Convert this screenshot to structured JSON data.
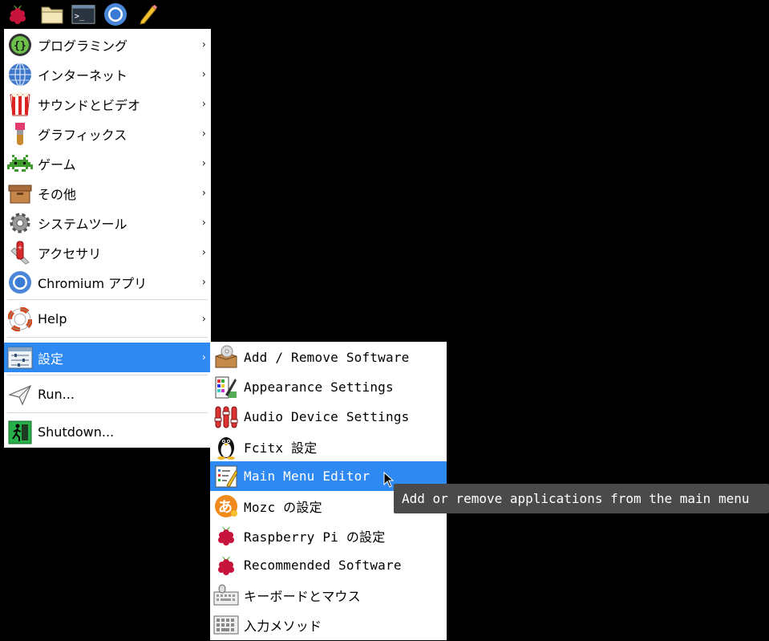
{
  "taskbar": {
    "items": [
      {
        "name": "raspberry-menu-icon"
      },
      {
        "name": "file-manager-icon"
      },
      {
        "name": "terminal-icon"
      },
      {
        "name": "chromium-icon"
      },
      {
        "name": "text-editor-icon"
      }
    ]
  },
  "main_menu": {
    "items": [
      {
        "label": "プログラミング",
        "icon": "programming-icon",
        "submenu": true
      },
      {
        "label": "インターネット",
        "icon": "internet-icon",
        "submenu": true
      },
      {
        "label": "サウンドとビデオ",
        "icon": "sound-video-icon",
        "submenu": true
      },
      {
        "label": "グラフィックス",
        "icon": "graphics-icon",
        "submenu": true
      },
      {
        "label": "ゲーム",
        "icon": "games-icon",
        "submenu": true
      },
      {
        "label": "その他",
        "icon": "other-icon",
        "submenu": true
      },
      {
        "label": "システムツール",
        "icon": "system-tools-icon",
        "submenu": true
      },
      {
        "label": "アクセサリ",
        "icon": "accessories-icon",
        "submenu": true
      },
      {
        "label": "Chromium アプリ",
        "icon": "chromium-apps-icon",
        "submenu": true
      },
      {
        "label": "Help",
        "icon": "help-icon",
        "submenu": true
      },
      {
        "label": "設定",
        "icon": "settings-icon",
        "submenu": true,
        "active": true
      },
      {
        "label": "Run...",
        "icon": "run-icon",
        "submenu": false
      },
      {
        "label": "Shutdown...",
        "icon": "shutdown-icon",
        "submenu": false
      }
    ],
    "arrow_glyph": "›"
  },
  "settings_submenu": {
    "items": [
      {
        "label": "Add / Remove Software",
        "icon": "add-remove-software-icon"
      },
      {
        "label": "Appearance Settings",
        "icon": "appearance-settings-icon"
      },
      {
        "label": "Audio Device Settings",
        "icon": "audio-device-settings-icon"
      },
      {
        "label": "Fcitx 設定",
        "icon": "fcitx-penguin-icon"
      },
      {
        "label": "Main Menu Editor",
        "icon": "main-menu-editor-icon",
        "active": true
      },
      {
        "label": "Mozc の設定",
        "icon": "mozc-icon"
      },
      {
        "label": "Raspberry Pi の設定",
        "icon": "raspberry-pi-config-icon"
      },
      {
        "label": "Recommended Software",
        "icon": "recommended-software-icon"
      },
      {
        "label": "キーボードとマウス",
        "icon": "keyboard-mouse-icon"
      },
      {
        "label": "入力メソッド",
        "icon": "input-method-icon"
      }
    ]
  },
  "tooltip": {
    "text": "Add or remove applications from the main menu"
  },
  "colors": {
    "highlight": "#2f89f2",
    "menu_bg": "#ffffff",
    "desktop_bg": "#000000",
    "tooltip_bg": "#4a4a4a"
  }
}
